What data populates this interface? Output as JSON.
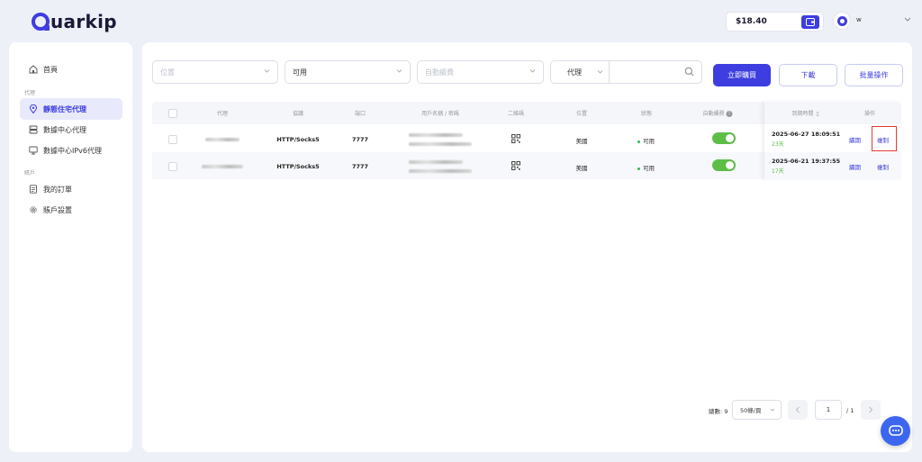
{
  "header": {
    "logo_text": "uarkip",
    "balance": "$18.40",
    "username_prefix": "w"
  },
  "sidebar": {
    "items": [
      {
        "label": "首頁",
        "icon": "home-icon"
      },
      {
        "label": "靜態住宅代理",
        "icon": "location-pin-icon",
        "active": true
      },
      {
        "label": "數據中心代理",
        "icon": "database-icon"
      },
      {
        "label": "數據中心IPv6代理",
        "icon": "monitor-icon"
      },
      {
        "label": "我的訂單",
        "icon": "document-icon"
      },
      {
        "label": "賬戶設置",
        "icon": "gear-icon"
      }
    ],
    "sections": [
      "代理",
      "賬戶"
    ]
  },
  "filters": {
    "location_placeholder": "位置",
    "status_value": "可用",
    "auto_renew_placeholder": "自動續費",
    "search_type_value": "代理",
    "search_placeholder": ""
  },
  "actions": {
    "buy_now": "立即購買",
    "download": "下載",
    "batch": "批量操作"
  },
  "table": {
    "headers": [
      "代理",
      "協議",
      "端口",
      "用戶名稱 / 密碼",
      "二維碼",
      "位置",
      "狀態",
      "自動續費",
      "到期時間",
      "操作"
    ],
    "rows": [
      {
        "protocol": "HTTP/Socks5",
        "port": "7777",
        "location": "美國",
        "status": "可用",
        "auto_renew": true,
        "expiry": "2025-06-27 18:09:51",
        "days_left": "23天",
        "renew": "續期",
        "copy": "複制"
      },
      {
        "protocol": "HTTP/Socks5",
        "port": "7777",
        "location": "美國",
        "status": "可用",
        "auto_renew": true,
        "expiry": "2025-06-21 19:37:55",
        "days_left": "17天",
        "renew": "續期",
        "copy": "複制"
      }
    ]
  },
  "pagination": {
    "total": "總數: 9",
    "page_size": "50條/頁",
    "current_page": "1",
    "of_pages": "/ 1"
  },
  "colors": {
    "accent": "#3d3de0",
    "success": "#5cbe47",
    "highlight": "#e53935"
  }
}
